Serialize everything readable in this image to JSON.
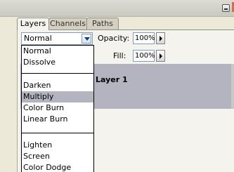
{
  "tabs": {
    "layers": "Layers",
    "channels": "Channels",
    "paths": "Paths"
  },
  "blend": {
    "selected_value": "Normal",
    "options": [
      "Normal",
      "Dissolve",
      "Darken",
      "Multiply",
      "Color Burn",
      "Linear Burn",
      "Lighten",
      "Screen",
      "Color Dodge"
    ],
    "highlighted": "Multiply"
  },
  "opacity": {
    "label": "Opacity:",
    "value": "100%"
  },
  "fill": {
    "label": "Fill:",
    "value": "100%"
  },
  "layer": {
    "name": "Layer 1"
  },
  "colors": {
    "panel": "#f4f3ee",
    "selection": "#b4b4c0",
    "field_border": "#7f9db9"
  }
}
